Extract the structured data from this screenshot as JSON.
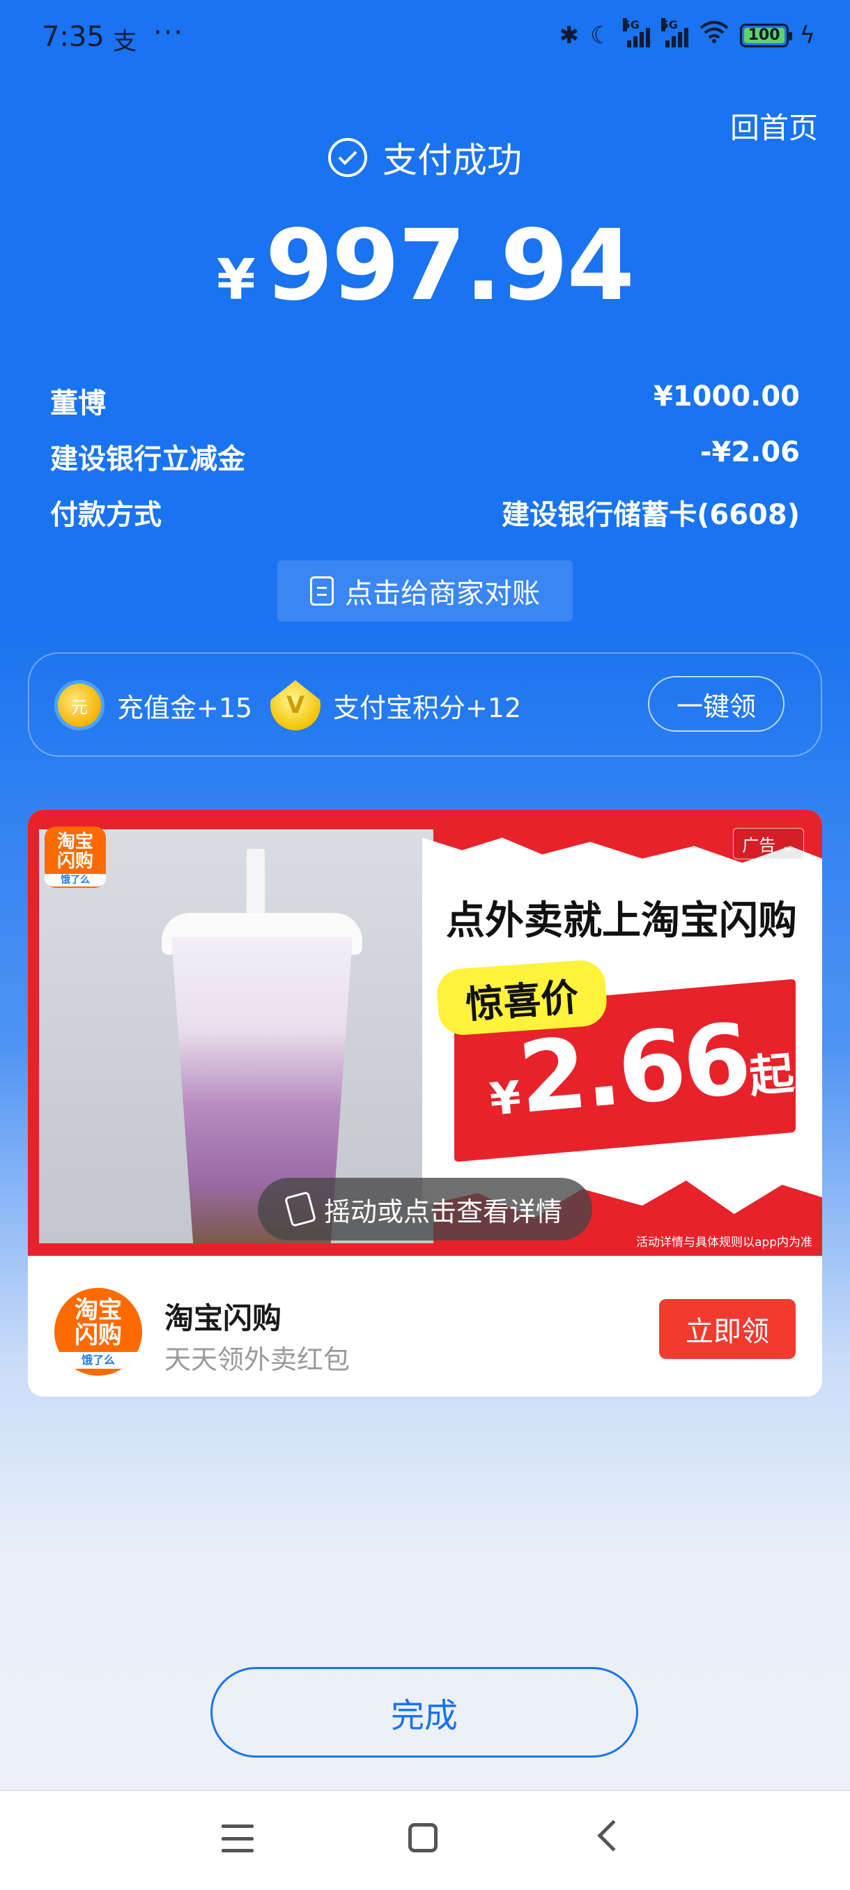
{
  "status_bar": {
    "time": "7:35",
    "app_icon": "alipay-icon",
    "dots": "···",
    "net_label_1": "5G",
    "net_label_2": "5G",
    "battery": "100"
  },
  "header": {
    "home_link": "回首页",
    "success_title": "支付成功",
    "currency": "¥",
    "amount": "997.94"
  },
  "details": [
    {
      "label": "董博",
      "value": "¥1000.00"
    },
    {
      "label": "建设银行立减金",
      "value": "-¥2.06"
    },
    {
      "label": "付款方式",
      "value": "建设银行储蓄卡(6608)"
    }
  ],
  "reconcile_button": "点击给商家对账",
  "rewards": {
    "items": [
      {
        "label": "充值金+15",
        "icon": "coin-icon"
      },
      {
        "label": "支付宝积分+12",
        "icon": "points-icon"
      }
    ],
    "claim_all": "一键领"
  },
  "ad": {
    "tag": "广告",
    "badge_line1": "淘宝",
    "badge_line2": "闪购",
    "badge_sub": "饿了么",
    "headline": "点外卖就上淘宝闪购",
    "price_tag": "惊喜价",
    "price_currency": "¥",
    "price_value": "2.66",
    "price_suffix": "起",
    "shake_tip": "摇动或点击查看详情",
    "disclaimer": "活动详情与具体规则以app内为准",
    "app_name": "淘宝闪购",
    "app_subtitle": "天天领外卖红包",
    "claim_button": "立即领"
  },
  "done_button": "完成",
  "colors": {
    "primary": "#1a73f0",
    "ad_red": "#e8222a",
    "claim_red": "#f23a2f",
    "brand_orange": "#ff6a00"
  }
}
